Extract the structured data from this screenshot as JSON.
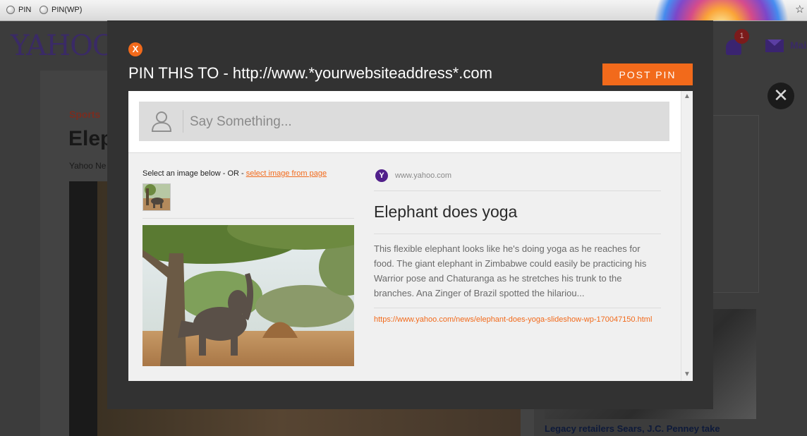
{
  "bookmarks": [
    {
      "label": "PIN",
      "icon": "globe-icon"
    },
    {
      "label": "PIN(WP)",
      "icon": "globe-icon"
    }
  ],
  "background_page": {
    "logo": "YAHOO",
    "mail_label": "Mai",
    "notification_count": "1",
    "close_symbol": "✕",
    "category": "Sports",
    "headline": "Elep",
    "byline": "Yahoo Ne",
    "sidebar_story": "Legacy retailers Sears, J.C. Penney take"
  },
  "modal": {
    "close_label": "X",
    "title": "PIN THIS TO - ",
    "target_url": "http://www.*yourwebsiteaddress*.com",
    "post_button": "POST PIN",
    "comment_placeholder": "Say Something...",
    "select_prefix": "Select an image below - OR - ",
    "select_link": "select image from page",
    "preview": {
      "site_letter": "Y",
      "site_domain": "www.yahoo.com",
      "title": "Elephant does yoga",
      "description": "This flexible elephant looks like he's doing yoga as he reaches for food. The giant elephant in Zimbabwe could easily be practicing his Warrior pose and Chaturanga as he stretches his trunk to the branches. Ana Zinger of Brazil spotted the hilariou...",
      "url": "https://www.yahoo.com/news/elephant-does-yoga-slideshow-wp-170047150.html"
    }
  },
  "colors": {
    "accent": "#f26a1b",
    "overlay": "#323232",
    "yahoo_purple": "#51208b"
  }
}
